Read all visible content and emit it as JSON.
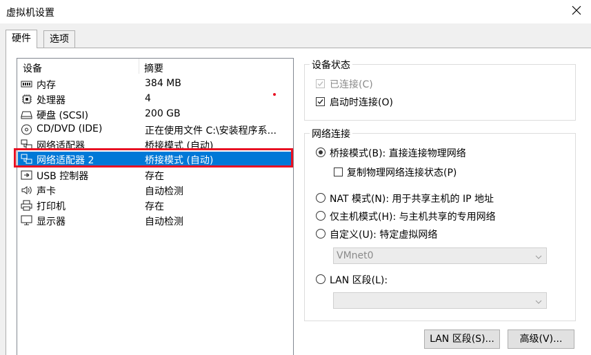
{
  "window": {
    "title": "虚拟机设置"
  },
  "tabs": [
    {
      "label": "硬件"
    },
    {
      "label": "选项"
    }
  ],
  "devices": {
    "col_device": "设备",
    "col_summary": "摘要",
    "rows": [
      {
        "name": "内存",
        "summary": "384 MB",
        "icon": "memory-icon"
      },
      {
        "name": "处理器",
        "summary": "4",
        "icon": "processor-icon"
      },
      {
        "name": "硬盘 (SCSI)",
        "summary": "200 GB",
        "icon": "hard-disk-icon"
      },
      {
        "name": "CD/DVD (IDE)",
        "summary": "正在使用文件 C:\\安装程序系...",
        "icon": "cd-dvd-icon"
      },
      {
        "name": "网络适配器",
        "summary": "桥接模式 (自动)",
        "icon": "network-adapter-icon"
      },
      {
        "name": "网络适配器 2",
        "summary": "桥接模式 (自动)",
        "icon": "network-adapter-icon"
      },
      {
        "name": "USB 控制器",
        "summary": "存在",
        "icon": "usb-icon"
      },
      {
        "name": "声卡",
        "summary": "自动检测",
        "icon": "speaker-icon"
      },
      {
        "name": "打印机",
        "summary": "存在",
        "icon": "printer-icon"
      },
      {
        "name": "显示器",
        "summary": "自动检测",
        "icon": "monitor-icon"
      }
    ],
    "selected_index": 5
  },
  "device_status": {
    "title": "设备状态",
    "connected": "已连接(C)",
    "connect_on_power_on": "启动时连接(O)"
  },
  "network": {
    "title": "网络连接",
    "bridged": "桥接模式(B): 直接连接物理网络",
    "replicate": "复制物理网络连接状态(P)",
    "nat": "NAT 模式(N): 用于共享主机的 IP 地址",
    "host_only": "仅主机模式(H): 与主机共享的专用网络",
    "custom": "自定义(U): 特定虚拟网络",
    "custom_value": "VMnet0",
    "lan_segment": "LAN 区段(L):",
    "lan_value": ""
  },
  "buttons": {
    "lan_segments": "LAN 区段(S)...",
    "advanced": "高级(V)..."
  },
  "colors": {
    "selection": "#0078d7",
    "highlight": "#e81123"
  }
}
